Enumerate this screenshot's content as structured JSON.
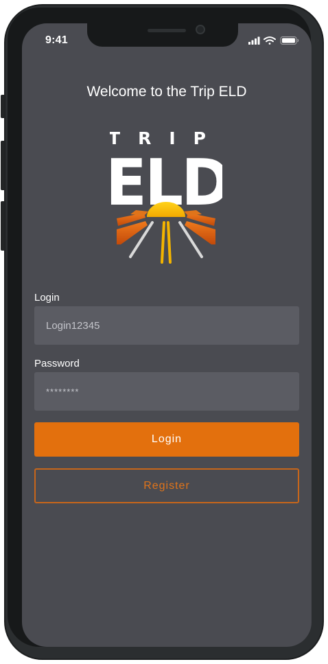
{
  "status_bar": {
    "time": "9:41",
    "icons": [
      "cellular-signal-icon",
      "wifi-icon",
      "battery-icon"
    ]
  },
  "welcome_text": "Welcome to the Trip ELD",
  "logo": {
    "top_text": "TRIP",
    "main_text": "ELD",
    "colors": {
      "sun": "#f5c400",
      "rays": "#e3700d",
      "road": "#d9d9d9",
      "text": "#ffffff"
    }
  },
  "form": {
    "login_label": "Login",
    "login_value": "Login12345",
    "password_label": "Password",
    "password_value": "********"
  },
  "buttons": {
    "login": "Login",
    "register": "Register"
  },
  "colors": {
    "background": "#4a4b51",
    "input_bg": "#5b5c63",
    "accent": "#e3700d"
  }
}
